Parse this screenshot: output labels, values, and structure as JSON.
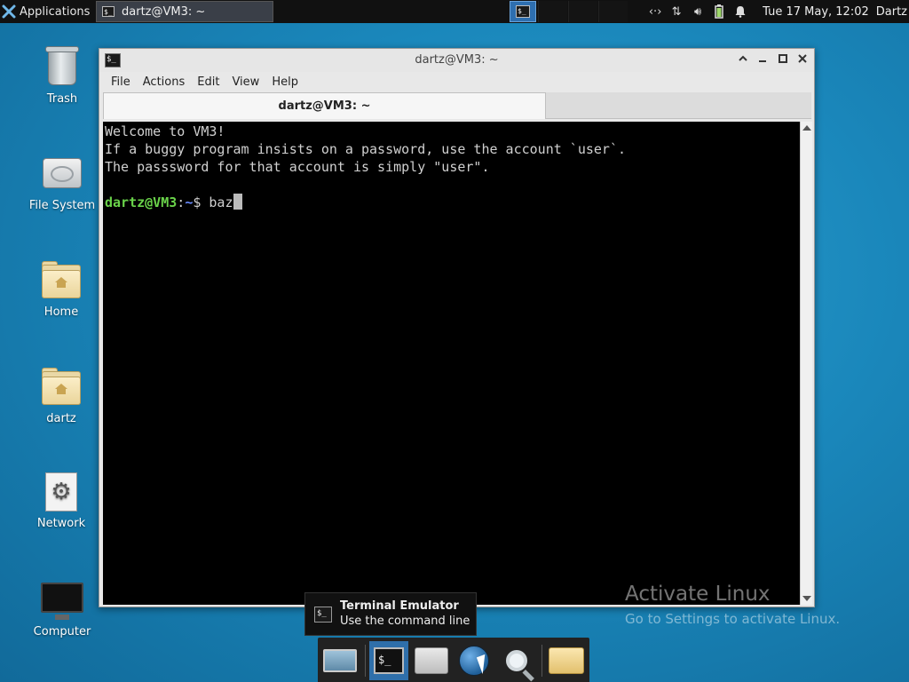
{
  "top_panel": {
    "applications_label": "Applications",
    "task_title": "dartz@VM3: ~",
    "clock": "Tue 17 May, 12:02",
    "user": "Dartz"
  },
  "desktop_icons": [
    {
      "label": "Trash",
      "icon": "trash-icon"
    },
    {
      "label": "File System",
      "icon": "drive-icon"
    },
    {
      "label": "Home",
      "icon": "home-folder-icon"
    },
    {
      "label": "dartz",
      "icon": "home-folder-icon"
    },
    {
      "label": "Network",
      "icon": "network-icon"
    },
    {
      "label": "Computer",
      "icon": "monitor-icon"
    }
  ],
  "window": {
    "title": "dartz@VM3: ~",
    "menu": [
      "File",
      "Actions",
      "Edit",
      "View",
      "Help"
    ],
    "tab_title": "dartz@VM3: ~",
    "terminal": {
      "lines": [
        "Welcome to VM3!",
        "If a buggy program insists on a password, use the account `user`.",
        "The passsword for that account is simply \"user\"."
      ],
      "prompt_user": "dartz@VM3",
      "prompt_sep": ":",
      "prompt_path": "~",
      "prompt_symbol": "$ ",
      "input": "baz"
    }
  },
  "tooltip": {
    "title": "Terminal Emulator",
    "subtitle": "Use the command line"
  },
  "watermark": {
    "title": "Activate Linux",
    "subtitle": "Go to Settings to activate Linux."
  },
  "dock_items": [
    "show-desktop-icon",
    "terminal-icon",
    "home-folder-icon",
    "web-browser-icon",
    "search-icon",
    "folder-icon"
  ],
  "colors": {
    "desktop": "#1a87bb",
    "prompt_user": "#6ad34a",
    "prompt_path": "#6a8cff"
  }
}
